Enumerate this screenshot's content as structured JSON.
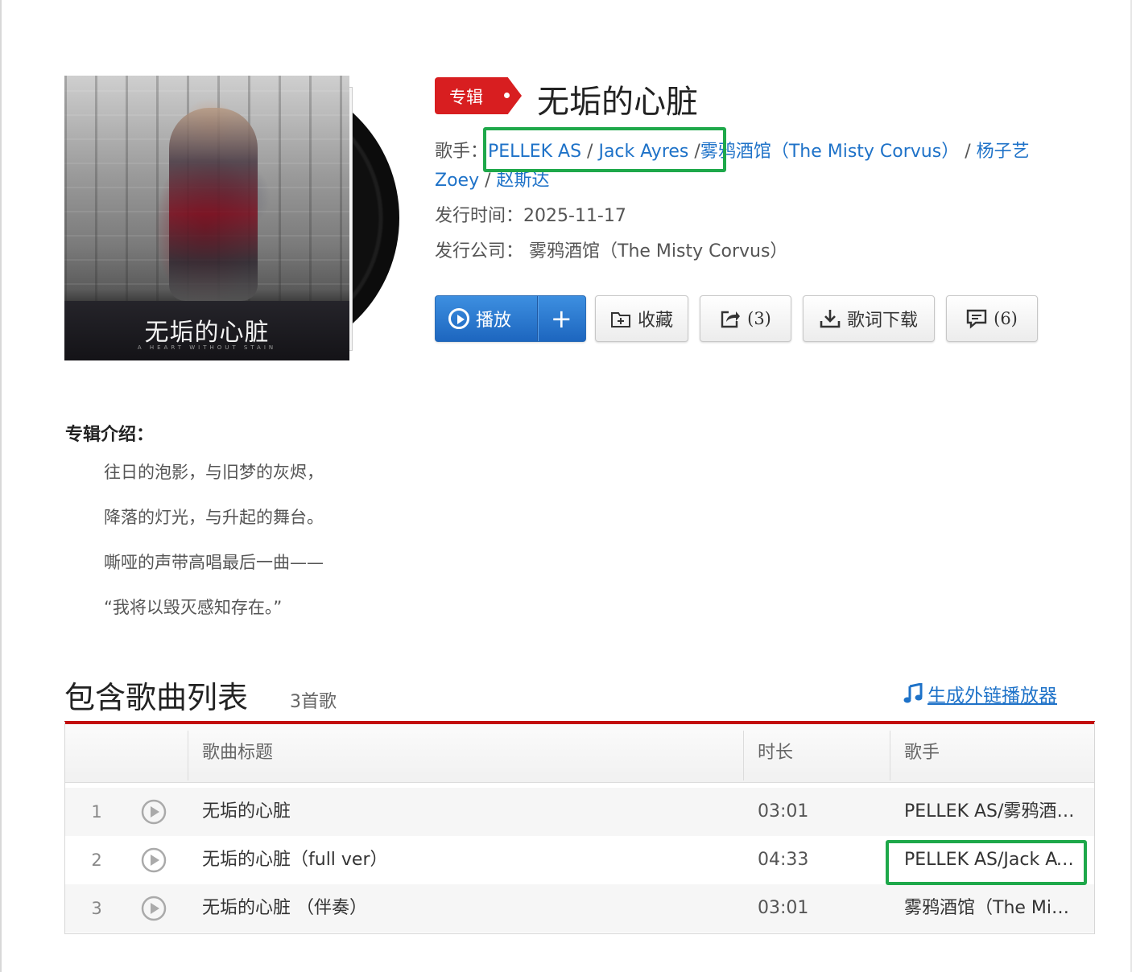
{
  "album": {
    "tag": "专辑",
    "title": "无垢的心脏",
    "cover_title": "无垢的心脏",
    "cover_subtitle": "A HEART WITHOUT STAIN",
    "artist_label": "歌手：",
    "artists": [
      "PELLEK AS",
      "Jack Ayres",
      "雾鸦酒馆（The Misty Corvus）",
      "杨子艺",
      "Zoey",
      "赵斯达"
    ],
    "artist_separator": "/",
    "release_label": "发行时间：",
    "release_date": "2025-11-17",
    "company_label": "发行公司：",
    "company": "雾鸦酒馆（The Misty Corvus）"
  },
  "buttons": {
    "play": "播放",
    "add": "+",
    "favorite": "收藏",
    "share_count": "(3)",
    "lyrics": "歌词下载",
    "comment_count": "(6)"
  },
  "intro": {
    "heading": "专辑介绍：",
    "lines": [
      "往日的泡影，与旧梦的灰烬，",
      "降落的灯光，与升起的舞台。",
      "嘶哑的声带高唱最后一曲——",
      "“我将以毁灭感知存在。”"
    ]
  },
  "songs": {
    "heading": "包含歌曲列表",
    "count": "3首歌",
    "external_player": "生成外链播放器",
    "columns": [
      "歌曲标题",
      "时长",
      "歌手"
    ],
    "rows": [
      {
        "index": "1",
        "title": "无垢的心脏",
        "duration": "03:01",
        "artist": "PELLEK AS/雾鸦酒馆（The Misty Corvus）"
      },
      {
        "index": "2",
        "title": "无垢的心脏（full ver）",
        "duration": "04:33",
        "artist": "PELLEK AS/Jack Ayres"
      },
      {
        "index": "3",
        "title": "无垢的心脏 （伴奏）",
        "duration": "03:01",
        "artist": "雾鸦酒馆（The Misty Corvus）"
      }
    ]
  },
  "colors": {
    "accent_red": "#c20c0c",
    "link_blue": "#1e72c8",
    "highlight_green": "#1ea84a",
    "play_blue": "#1d66bf"
  }
}
